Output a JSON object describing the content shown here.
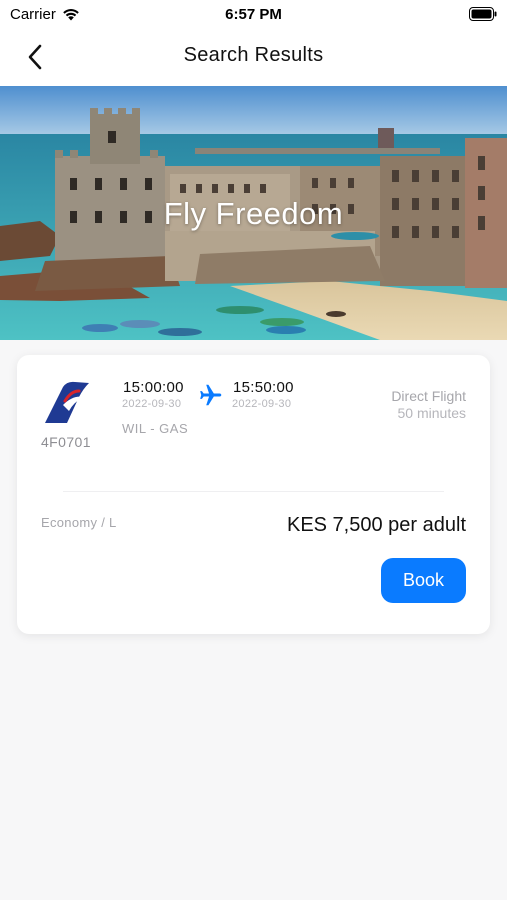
{
  "status_bar": {
    "carrier": "Carrier",
    "time": "6:57 PM",
    "wifi_icon": "wifi-icon",
    "battery_icon": "battery-icon"
  },
  "nav": {
    "title": "Search Results",
    "back_icon": "chevron-left-icon"
  },
  "hero": {
    "title": "Fly Freedom"
  },
  "flight": {
    "airline_logo_icon": "airline-tail-logo",
    "code": "4F0701",
    "departure_time": "15:00:00",
    "departure_date": "2022-09-30",
    "arrival_time": "15:50:00",
    "arrival_date": "2022-09-30",
    "route": "WIL - GAS",
    "type": "Direct Flight",
    "duration": "50 minutes",
    "cabin": "Economy / L",
    "price": "KES 7,500 per adult",
    "book_label": "Book",
    "plane_icon": "airplane-icon"
  },
  "colors": {
    "accent": "#0a7bff",
    "logo_blue": "#1f3a93",
    "logo_red": "#d9242a",
    "background": "#f7f7f8"
  }
}
